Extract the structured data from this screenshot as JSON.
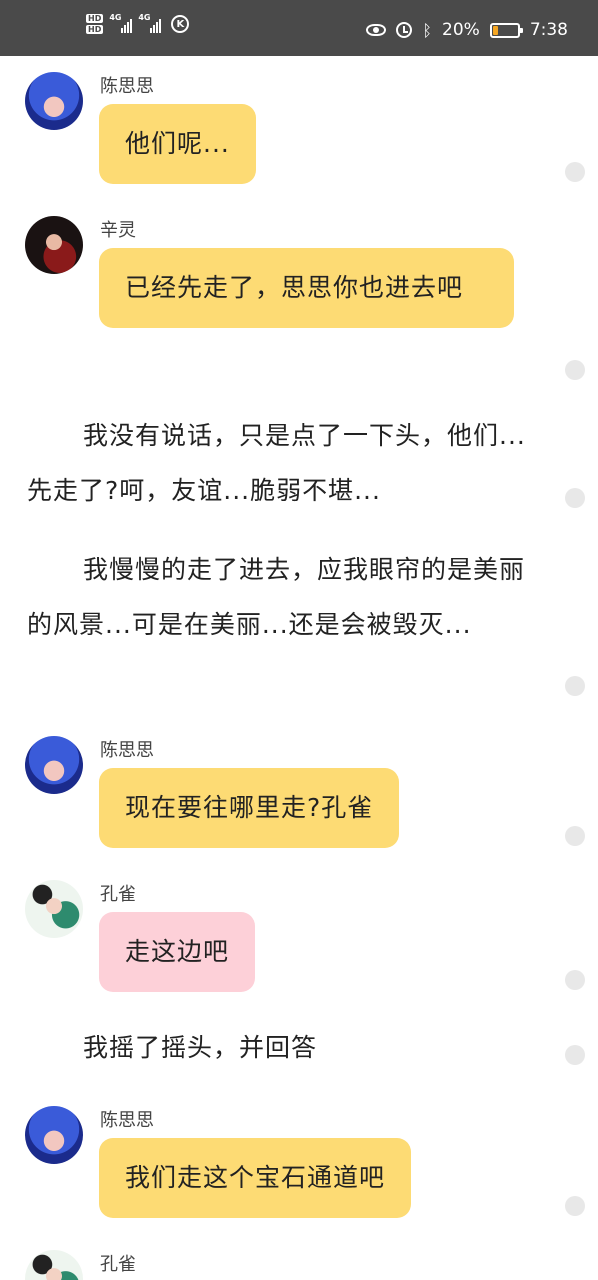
{
  "status_bar": {
    "hd_top": "HD",
    "hd_bottom": "HD",
    "network1": "4G",
    "network2": "4G",
    "k_label": "K",
    "battery_text": "20%",
    "battery_level": 0.2,
    "time": "7:38"
  },
  "messages": [
    {
      "type": "bubble",
      "sender": "陈思思",
      "text": "他们呢...",
      "color": "#fddb74"
    },
    {
      "type": "bubble",
      "sender": "辛灵",
      "text": "已经先走了，思思你也进去吧",
      "color": "#fddb74"
    },
    {
      "type": "narration",
      "text": "我没有说话，只是点了一下头，他们...先走了?呵，友谊...脆弱不堪..."
    },
    {
      "type": "narration",
      "text": "我慢慢的走了进去，应我眼帘的是美丽的风景...可是在美丽...还是会被毁灭..."
    },
    {
      "type": "bubble",
      "sender": "陈思思",
      "text": "现在要往哪里走?孔雀",
      "color": "#fddb74"
    },
    {
      "type": "bubble",
      "sender": "孔雀",
      "text": "走这边吧",
      "color": "#fdd0d8"
    },
    {
      "type": "narration",
      "text": "我摇了摇头，并回答"
    },
    {
      "type": "bubble",
      "sender": "陈思思",
      "text": "我们走这个宝石通道吧",
      "color": "#fddb74"
    },
    {
      "type": "bubble",
      "sender": "孔雀",
      "text": "",
      "color": "#fdd0d8"
    }
  ]
}
